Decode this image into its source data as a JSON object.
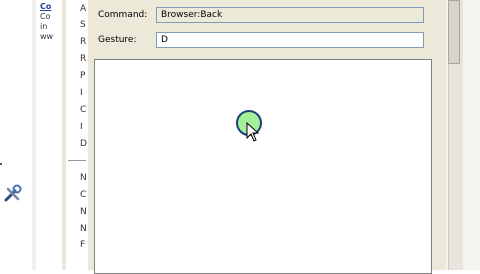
{
  "left_snippet": {
    "lines": [
      "Co",
      "Co",
      "in",
      "ww"
    ]
  },
  "sidebar": {
    "items": [
      "A",
      "S",
      "R",
      "R",
      "P",
      "I",
      "C",
      "I",
      "D",
      "N",
      "C",
      "N",
      "N",
      "F"
    ]
  },
  "form": {
    "command_label": "Command:",
    "command_value": "Browser:Back",
    "gesture_label": "Gesture:",
    "gesture_value": "D"
  },
  "icons": {
    "tools": "tools-icon",
    "cursor": "arrow-cursor-icon",
    "gesture_point": "gesture-dot-icon"
  },
  "colors": {
    "dialog_bg": "#ece9d8",
    "gesture_fill": "#a4f19a",
    "gesture_border": "#1d3f7a"
  }
}
